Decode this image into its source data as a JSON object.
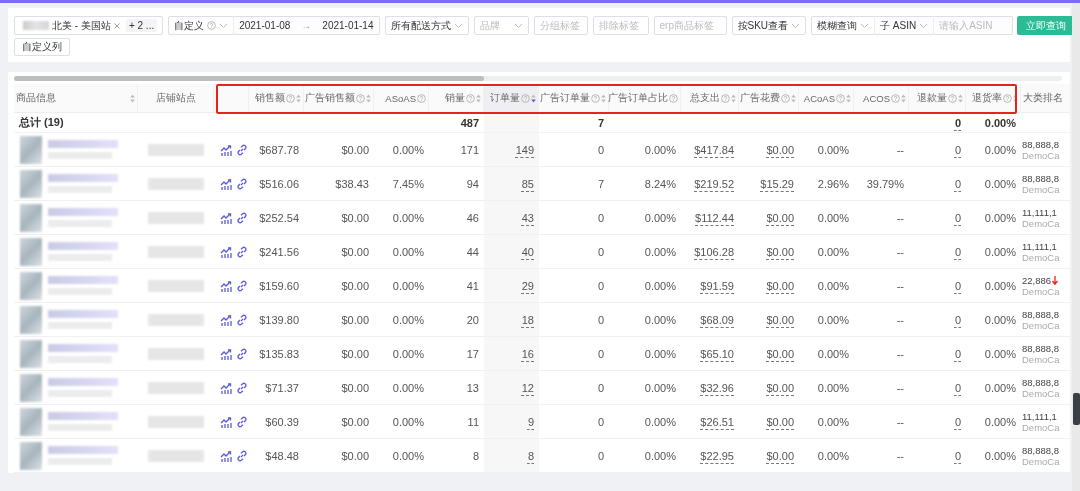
{
  "filters": [
    {
      "kind": "tags",
      "tags": [
        {
          "label": "北美 - 美国站",
          "removable": true,
          "blurred": true
        },
        {
          "label": "+ 2 ...",
          "removable": false,
          "blurred": false
        }
      ]
    },
    {
      "kind": "select",
      "value": "自定义",
      "help": true
    },
    {
      "kind": "daterange",
      "start": "2021-01-08",
      "separator": "→",
      "end": "2021-01-14"
    },
    {
      "kind": "select",
      "value": "所有配送方式",
      "help": false
    },
    {
      "kind": "select",
      "placeholder": "品牌",
      "help": false
    },
    {
      "kind": "input",
      "placeholder": "分组标签"
    },
    {
      "kind": "input",
      "placeholder": "排除标签"
    },
    {
      "kind": "input",
      "placeholder": "erp商品标签"
    },
    {
      "kind": "select",
      "value": "按SKU查看",
      "help": false
    },
    {
      "kind": "select",
      "value": "模糊查询",
      "help": false
    },
    {
      "kind": "select",
      "value": "子 ASIN",
      "help": false
    },
    {
      "kind": "input",
      "placeholder": "请输入ASIN"
    }
  ],
  "query_button": "立即查询",
  "custom_columns_button": "自定义列",
  "table": {
    "info_columns": [
      {
        "label": "商品信息",
        "help": false,
        "sortable": true,
        "sorted": false
      },
      {
        "label": "店铺站点",
        "help": false,
        "sortable": false
      }
    ],
    "metric_columns": [
      {
        "label": "销售额",
        "help": true,
        "sortable": true,
        "sorted": false,
        "linked": false
      },
      {
        "label": "广告销售额",
        "help": true,
        "sortable": true,
        "sorted": false,
        "linked": false
      },
      {
        "label": "ASoAS",
        "help": true,
        "sortable": false,
        "linked": false
      },
      {
        "label": "销量",
        "help": true,
        "sortable": true,
        "sorted": false,
        "linked": false
      },
      {
        "label": "订单量",
        "help": true,
        "sortable": true,
        "sorted": true,
        "linked": true
      },
      {
        "label": "广告订单量",
        "help": true,
        "sortable": true,
        "sorted": false,
        "linked": false
      },
      {
        "label": "广告订单占比",
        "help": true,
        "sortable": false,
        "linked": false
      },
      {
        "label": "总支出",
        "help": true,
        "sortable": true,
        "sorted": false,
        "linked": true
      },
      {
        "label": "广告花费",
        "help": true,
        "sortable": true,
        "sorted": false,
        "linked": true
      },
      {
        "label": "ACoAS",
        "help": true,
        "sortable": true,
        "sorted": false,
        "linked": false
      },
      {
        "label": "ACOS",
        "help": true,
        "sortable": true,
        "sorted": false,
        "linked": false
      },
      {
        "label": "退款量",
        "help": true,
        "sortable": true,
        "sorted": false,
        "linked": true
      },
      {
        "label": "退货率",
        "help": true,
        "sortable": true,
        "sorted": false,
        "linked": false
      }
    ],
    "rank_column": {
      "label": "大类排名"
    },
    "total_label": "总计 (19)",
    "totals": {
      "units": "487",
      "ad_orders": "7",
      "refunds": "0",
      "return_rate": "0.00%"
    },
    "rows": [
      {
        "cells": [
          "$687.78",
          "$0.00",
          "0.00%",
          "171",
          "149",
          "0",
          "0.00%",
          "$417.84",
          "$0.00",
          "0.00%",
          "--",
          "0",
          "0.00%"
        ],
        "rank": "88,888,8",
        "rank_down": false,
        "category": "DemoCa"
      },
      {
        "cells": [
          "$516.06",
          "$38.43",
          "7.45%",
          "94",
          "85",
          "7",
          "8.24%",
          "$219.52",
          "$15.29",
          "2.96%",
          "39.79%",
          "0",
          "0.00%"
        ],
        "rank": "88,888,8",
        "rank_down": false,
        "category": "DemoCa"
      },
      {
        "cells": [
          "$252.54",
          "$0.00",
          "0.00%",
          "46",
          "43",
          "0",
          "0.00%",
          "$112.44",
          "$0.00",
          "0.00%",
          "--",
          "0",
          "0.00%"
        ],
        "rank": "11,111,1",
        "rank_down": false,
        "category": "DemoCa"
      },
      {
        "cells": [
          "$241.56",
          "$0.00",
          "0.00%",
          "44",
          "40",
          "0",
          "0.00%",
          "$106.28",
          "$0.00",
          "0.00%",
          "--",
          "0",
          "0.00%"
        ],
        "rank": "11,111,1",
        "rank_down": false,
        "category": "DemoCa"
      },
      {
        "cells": [
          "$159.60",
          "$0.00",
          "0.00%",
          "41",
          "29",
          "0",
          "0.00%",
          "$91.59",
          "$0.00",
          "0.00%",
          "--",
          "0",
          "0.00%"
        ],
        "rank": "22,886",
        "rank_down": true,
        "category": "DemoCa"
      },
      {
        "cells": [
          "$139.80",
          "$0.00",
          "0.00%",
          "20",
          "18",
          "0",
          "0.00%",
          "$68.09",
          "$0.00",
          "0.00%",
          "--",
          "0",
          "0.00%"
        ],
        "rank": "88,888,8",
        "rank_down": false,
        "category": "DemoCa"
      },
      {
        "cells": [
          "$135.83",
          "$0.00",
          "0.00%",
          "17",
          "16",
          "0",
          "0.00%",
          "$65.10",
          "$0.00",
          "0.00%",
          "--",
          "0",
          "0.00%"
        ],
        "rank": "88,888,8",
        "rank_down": false,
        "category": "DemoCa"
      },
      {
        "cells": [
          "$71.37",
          "$0.00",
          "0.00%",
          "13",
          "12",
          "0",
          "0.00%",
          "$32.96",
          "$0.00",
          "0.00%",
          "--",
          "0",
          "0.00%"
        ],
        "rank": "88,888,8",
        "rank_down": false,
        "category": "DemoCa"
      },
      {
        "cells": [
          "$60.39",
          "$0.00",
          "0.00%",
          "11",
          "9",
          "0",
          "0.00%",
          "$26.51",
          "$0.00",
          "0.00%",
          "--",
          "0",
          "0.00%"
        ],
        "rank": "11,111,1",
        "rank_down": false,
        "category": "DemoCa"
      },
      {
        "cells": [
          "$48.48",
          "$0.00",
          "0.00%",
          "8",
          "8",
          "0",
          "0.00%",
          "$22.95",
          "$0.00",
          "0.00%",
          "--",
          "0",
          "0.00%"
        ],
        "rank": "88,888,8",
        "rank_down": false,
        "category": "DemoCa"
      }
    ]
  }
}
